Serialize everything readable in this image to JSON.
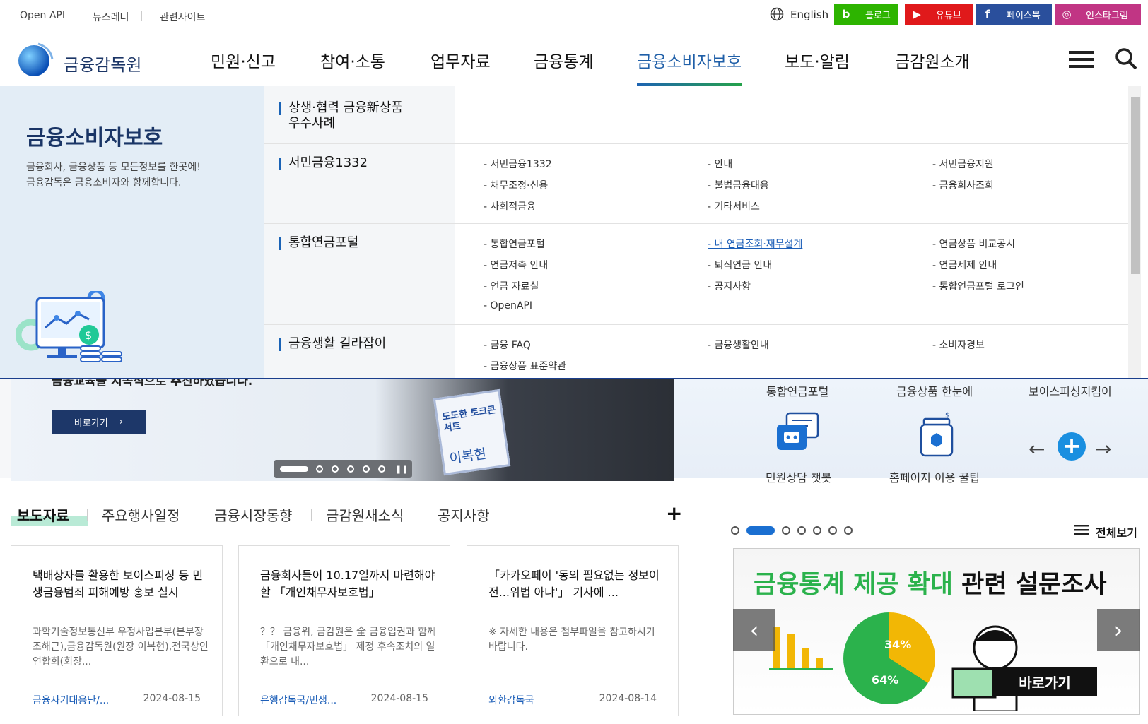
{
  "util": {
    "openapi": "Open API",
    "newsletter": "뉴스레터",
    "related": "관련사이트",
    "english": "English"
  },
  "sns": [
    {
      "label": "블로그",
      "icon": "b",
      "color": "#2db400"
    },
    {
      "label": "유튜브",
      "icon": "▶",
      "color": "#e0191b"
    },
    {
      "label": "페이스북",
      "icon": "f",
      "color": "#2a4f9c"
    },
    {
      "label": "인스타그램",
      "icon": "◎",
      "color": "#c13584"
    }
  ],
  "logo": {
    "text": "금융감독원"
  },
  "gnb": [
    "민원·신고",
    "참여·소통",
    "업무자료",
    "금융통계",
    "금융소비자보호",
    "보도·알림",
    "금감원소개"
  ],
  "mega": {
    "title": "금융소비자보호",
    "desc1": "금융회사, 금융상품 등 모든정보를 한곳에!",
    "desc2": "금융감독은 금융소비자와 함께합니다.",
    "categories": [
      {
        "name1": "상생·협력 금융新상품",
        "name2": "우수사례",
        "items": []
      },
      {
        "name1": "서민금융1332",
        "items": [
          "- 서민금융1332",
          "- 안내",
          "- 서민금융지원",
          "- 채무조정·신용",
          "- 불법금융대응",
          "- 금융회사조회",
          "- 사회적금융",
          "- 기타서비스"
        ]
      },
      {
        "name1": "통합연금포털",
        "items": [
          "- 통합연금포털",
          "- 내 연금조회·재무설계",
          "- 연금상품 비교공시",
          "- 연금저축 안내",
          "- 퇴직연금 안내",
          "- 연금세제 안내",
          "- 연금 자료실",
          "- 공지사항",
          "- 통합연금포털 로그인",
          "- OpenAPI"
        ]
      },
      {
        "name1": "금융생활 길라잡이",
        "items": [
          "- 금융 FAQ",
          "- 금융생활안내",
          "- 소비자경보",
          "- 금융상품 표준약관"
        ]
      }
    ]
  },
  "banner": {
    "caption": "금융교육을 지속적으로 추진하였습니다.",
    "button": "바로가기",
    "sign1": "도도한 토크콘서트",
    "sign2": "이복현"
  },
  "quick": {
    "top": [
      "통합연금포털",
      "금융상품 한눈에",
      "보이스피싱지킴이"
    ],
    "bottom": [
      "민원상담 챗봇",
      "홈페이지 이용 꿀팁"
    ]
  },
  "tabs": [
    "보도자료",
    "주요행사일정",
    "금융시장동향",
    "금감원새소식",
    "공지사항"
  ],
  "cards": [
    {
      "title": "택배상자를 활용한 보이스피싱 등 민생금융범죄 피해예방 홍보 실시",
      "body": "과학기술정보통신부 우정사업본부(본부장 조해근),금융감독원(원장 이복현),전국상인연합회(회장...",
      "dept": "금융사기대응단/...",
      "date": "2024-08-15"
    },
    {
      "title": "금융회사들이 10.17일까지 마련해야할 「개인채무자보호법」",
      "body": "？？ 금융위, 금감원은 全 금융업권과 함께 「개인채무자보호법」 제정 후속조치의 일환으로 내...",
      "dept": "은행감독국/민생...",
      "date": "2024-08-15"
    },
    {
      "title": "「카카오페이 '동의 필요없는 정보이전...위법 아냐'」 기사에 ...",
      "body": "※ 자세한 내용은 첨부파일을 참고하시기 바랍니다.",
      "dept": "외환감독국",
      "date": "2024-08-14"
    }
  ],
  "allview": "전체보기",
  "survey": {
    "title_green": "금융통계 제공 확대",
    "title_black": "관련 설문조사",
    "button": "바로가기",
    "p1": "34%",
    "p2": "64%"
  }
}
